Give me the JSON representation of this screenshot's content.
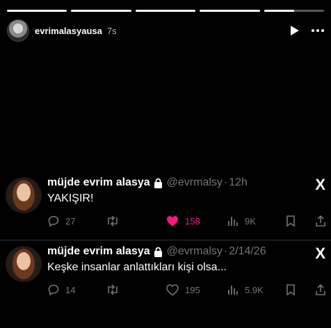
{
  "story": {
    "progress": [
      1,
      1,
      1,
      1,
      0.5
    ],
    "username": "evrimalasyausa",
    "time": "7s",
    "play_icon": "play-icon",
    "more_icon": "more-icon"
  },
  "tweets": [
    {
      "name": "müjde evrim alasya",
      "handle": "@evrmalsy",
      "dot": "·",
      "time": "12h",
      "text": "YAKIŞIR!",
      "replies": "27",
      "retweets": "",
      "likes": "158",
      "views": "9K",
      "liked": true
    },
    {
      "name": "müjde evrim alasya",
      "handle": "@evrmalsy",
      "dot": "·",
      "time": "2/14/26",
      "text": "Keşke insanlar anlattıkları kişi olsa...",
      "replies": "14",
      "retweets": "",
      "likes": "195",
      "views": "5.9K",
      "liked": false
    }
  ],
  "brand": {
    "x_logo": "X",
    "like_color": "#f91880",
    "muted_color": "#71767b"
  }
}
